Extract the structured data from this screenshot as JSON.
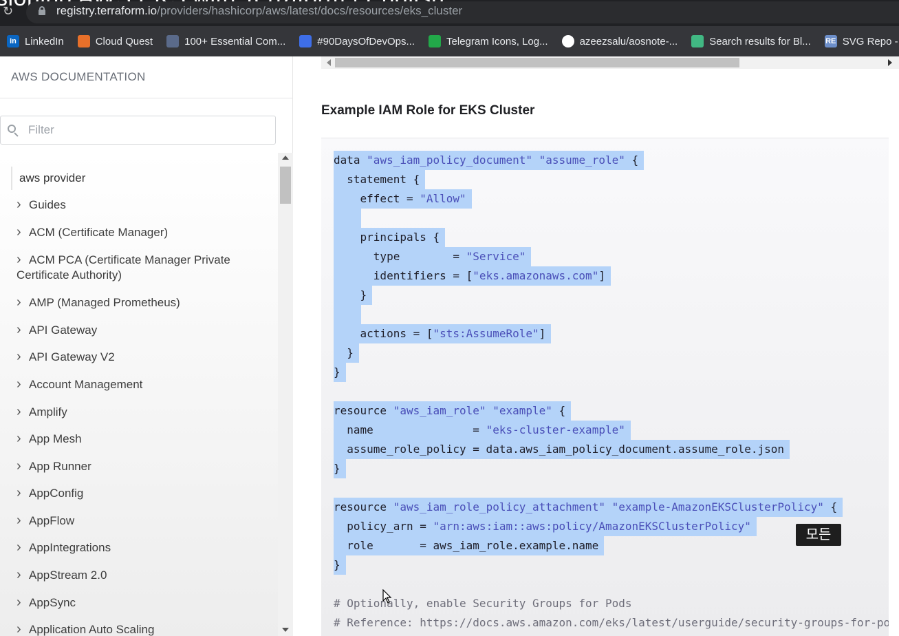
{
  "browser": {
    "title_fragment": "sioning AWS EKS with Terraform | English",
    "url_host": "registry.terraform.io",
    "url_path": "/providers/hashicorp/aws/latest/docs/resources/eks_cluster",
    "bookmarks": [
      {
        "label": "LinkedIn",
        "icon": "linkedin-icon",
        "color": "#0a66c2",
        "glyph": "in"
      },
      {
        "label": "Cloud Quest",
        "icon": "cloud-quest-icon",
        "color": "#e8702a",
        "glyph": ""
      },
      {
        "label": "100+ Essential Com...",
        "icon": "essential-commands-icon",
        "color": "#5a6a8a",
        "glyph": ""
      },
      {
        "label": "#90DaysOfDevOps...",
        "icon": "devops-icon",
        "color": "#3e6ee8",
        "glyph": ""
      },
      {
        "label": "Telegram Icons, Log...",
        "icon": "telegram-icons-icon",
        "color": "#22a849",
        "glyph": ""
      },
      {
        "label": "azeezsalu/aosnote-...",
        "icon": "github-icon",
        "color": "#ffffff",
        "glyph": ""
      },
      {
        "label": "Search results for Bl...",
        "icon": "search-results-icon",
        "color": "#41b883",
        "glyph": ""
      },
      {
        "label": "SVG Repo -",
        "icon": "svg-repo-icon",
        "color": "#6c8ec9",
        "glyph": "RE"
      }
    ]
  },
  "sidebar": {
    "header": "AWS DOCUMENTATION",
    "filter_placeholder": "Filter",
    "root_item": "aws provider",
    "items": [
      {
        "label": "Guides"
      },
      {
        "label": "ACM (Certificate Manager)"
      },
      {
        "label": "ACM PCA (Certificate Manager Private Certificate Authority)"
      },
      {
        "label": "AMP (Managed Prometheus)"
      },
      {
        "label": "API Gateway"
      },
      {
        "label": "API Gateway V2"
      },
      {
        "label": "Account Management"
      },
      {
        "label": "Amplify"
      },
      {
        "label": "App Mesh"
      },
      {
        "label": "App Runner"
      },
      {
        "label": "AppConfig"
      },
      {
        "label": "AppFlow"
      },
      {
        "label": "AppIntegrations"
      },
      {
        "label": "AppStream 2.0"
      },
      {
        "label": "AppSync"
      },
      {
        "label": "Application Auto Scaling"
      }
    ]
  },
  "main": {
    "section_title": "Example IAM Role for EKS Cluster",
    "code_lines": [
      {
        "t": "data \"aws_iam_policy_document\" \"assume_role\" {",
        "sel": true
      },
      {
        "t": "  statement {",
        "sel": true
      },
      {
        "t": "    effect = \"Allow\"",
        "sel": true
      },
      {
        "t": "",
        "sel": true
      },
      {
        "t": "    principals {",
        "sel": true
      },
      {
        "t": "      type        = \"Service\"",
        "sel": true
      },
      {
        "t": "      identifiers = [\"eks.amazonaws.com\"]",
        "sel": true
      },
      {
        "t": "    }",
        "sel": true
      },
      {
        "t": "",
        "sel": true
      },
      {
        "t": "    actions = [\"sts:AssumeRole\"]",
        "sel": true
      },
      {
        "t": "  }",
        "sel": true
      },
      {
        "t": "}",
        "sel": true
      },
      {
        "t": "",
        "sel": false
      },
      {
        "t": "resource \"aws_iam_role\" \"example\" {",
        "sel": true
      },
      {
        "t": "  name               = \"eks-cluster-example\"",
        "sel": true
      },
      {
        "t": "  assume_role_policy = data.aws_iam_policy_document.assume_role.json",
        "sel": true
      },
      {
        "t": "}",
        "sel": true
      },
      {
        "t": "",
        "sel": false
      },
      {
        "t": "resource \"aws_iam_role_policy_attachment\" \"example-AmazonEKSClusterPolicy\" {",
        "sel": true
      },
      {
        "t": "  policy_arn = \"arn:aws:iam::aws:policy/AmazonEKSClusterPolicy\"",
        "sel": true
      },
      {
        "t": "  role       = aws_iam_role.example.name",
        "sel": true
      },
      {
        "t": "}",
        "sel": true
      },
      {
        "t": "",
        "sel": false
      },
      {
        "t": "# Optionally, enable Security Groups for Pods",
        "sel": false,
        "comment": true
      },
      {
        "t": "# Reference: https://docs.aws.amazon.com/eks/latest/userguide/security-groups-for-pods.html",
        "sel": false,
        "comment": true
      }
    ],
    "tooltip": "모든"
  },
  "colors": {
    "selection": "#b4d3f9",
    "string": "#4a4fb8",
    "chrome_dark": "#202124",
    "bookmarks_bar": "#35363a"
  }
}
